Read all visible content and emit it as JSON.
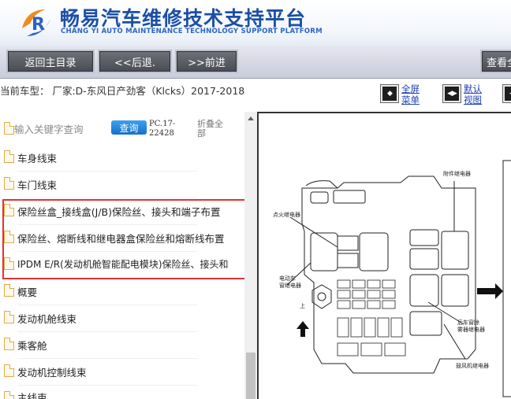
{
  "header": {
    "title_cn": "畅易汽车维修技术支持平台",
    "title_en": "CHANG YI AUTO MAINTENANCE TECHNOLOGY SUPPORT PLATFORM"
  },
  "toolbar": {
    "home_label": "返回主目录",
    "back_label": "<<后退.",
    "forward_label": ">>前进",
    "view_label": "查看全"
  },
  "info": {
    "car_model": "当前车型： 厂家:D-东风日产劲客（Klcks）2017-2018",
    "fullscreen_label": "全屏菜单",
    "default_view_label": "默认视图"
  },
  "search": {
    "placeholder": "输入关键字查询",
    "query_label": "查询",
    "pc_code": "PC.17-22428",
    "collapse_label": "折叠全部"
  },
  "tree": {
    "items": [
      {
        "label": "车身线束"
      },
      {
        "label": "车门线束"
      },
      {
        "label": "保险丝盒_接线盒(J/B)保险丝、接头和端子布置"
      },
      {
        "label": "保险丝、熔断线和继电器盒保险丝和熔断线布置"
      },
      {
        "label": "IPDM E/R(发动机舱智能配电模块)保险丝、接头和"
      },
      {
        "label": "概要"
      },
      {
        "label": "发动机舱线束"
      },
      {
        "label": "乘客舱"
      },
      {
        "label": "发动机控制线束"
      },
      {
        "label": "主线束"
      }
    ]
  },
  "diagram": {
    "labels": {
      "attach_relay": "附件继电器",
      "ignition_relay": "点火继电器",
      "fan_relay": "电动车\n窗继电器",
      "up": "上",
      "rear_defrost": "后车窗除\n雾器继电器",
      "blower_relay": "鼓风机继电器"
    }
  },
  "colors": {
    "brand_blue": "#1a4fa6",
    "query_blue": "#1570c9",
    "highlight_red": "#e03333"
  }
}
